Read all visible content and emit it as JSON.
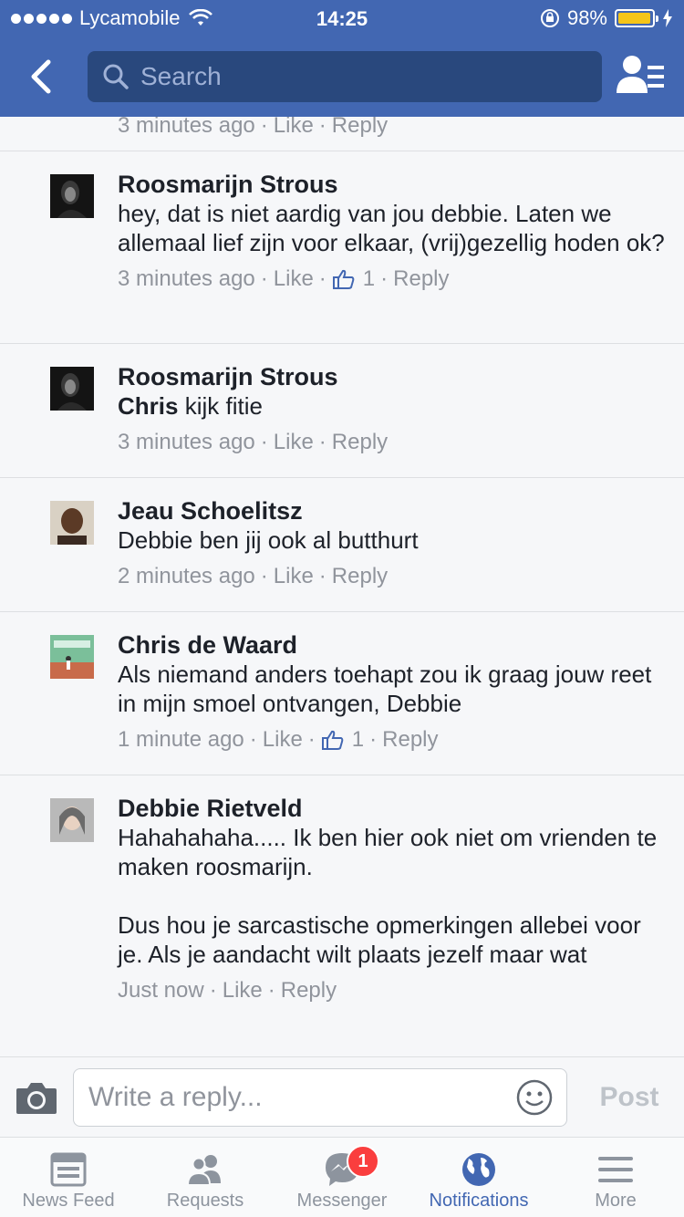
{
  "status_bar": {
    "carrier": "Lycamobile",
    "time": "14:25",
    "battery": "98%",
    "battery_level": 0.98
  },
  "header": {
    "search_placeholder": "Search"
  },
  "partial_comment": {
    "time": "3 minutes ago",
    "like": "Like",
    "reply": "Reply"
  },
  "comments": [
    {
      "name": "Roosmarijn Strous",
      "text": "hey, dat is niet aardig van jou debbie. Laten we allemaal lief zijn voor elkaar, (vrij)gezellig hoden ok?",
      "time": "3 minutes ago",
      "like": "Like",
      "likes": "1",
      "reply": "Reply"
    },
    {
      "name": "Roosmarijn Strous",
      "tag": "Chris",
      "text": " kijk fitie",
      "time": "3 minutes ago",
      "like": "Like",
      "reply": "Reply"
    },
    {
      "name": "Jeau Schoelitsz",
      "text": "Debbie ben jij ook al butthurt",
      "time": "2 minutes ago",
      "like": "Like",
      "reply": "Reply"
    },
    {
      "name": "Chris de Waard",
      "text": "Als niemand anders toehapt zou ik graag jouw reet in mijn smoel ontvangen, Debbie",
      "time": "1 minute ago",
      "like": "Like",
      "likes": "1",
      "reply": "Reply"
    },
    {
      "name": "Debbie Rietveld",
      "text": "Hahahahaha..... Ik ben hier ook niet om vrienden te maken roosmarijn.\n\nDus hou je sarcastische opmerkingen allebei voor je. Als je aandacht wilt plaats jezelf maar wat",
      "time": "Just now",
      "like": "Like",
      "reply": "Reply"
    }
  ],
  "reply_bar": {
    "placeholder": "Write a reply...",
    "post": "Post"
  },
  "tabs": [
    {
      "label": "News Feed",
      "icon": "news-feed-icon"
    },
    {
      "label": "Requests",
      "icon": "requests-icon"
    },
    {
      "label": "Messenger",
      "icon": "messenger-icon",
      "badge": "1"
    },
    {
      "label": "Notifications",
      "icon": "globe-icon",
      "active": true
    },
    {
      "label": "More",
      "icon": "menu-icon"
    }
  ],
  "colors": {
    "brand": "#4267b2",
    "meta_gray": "#90949c",
    "badge_red": "#fa3e3e"
  }
}
